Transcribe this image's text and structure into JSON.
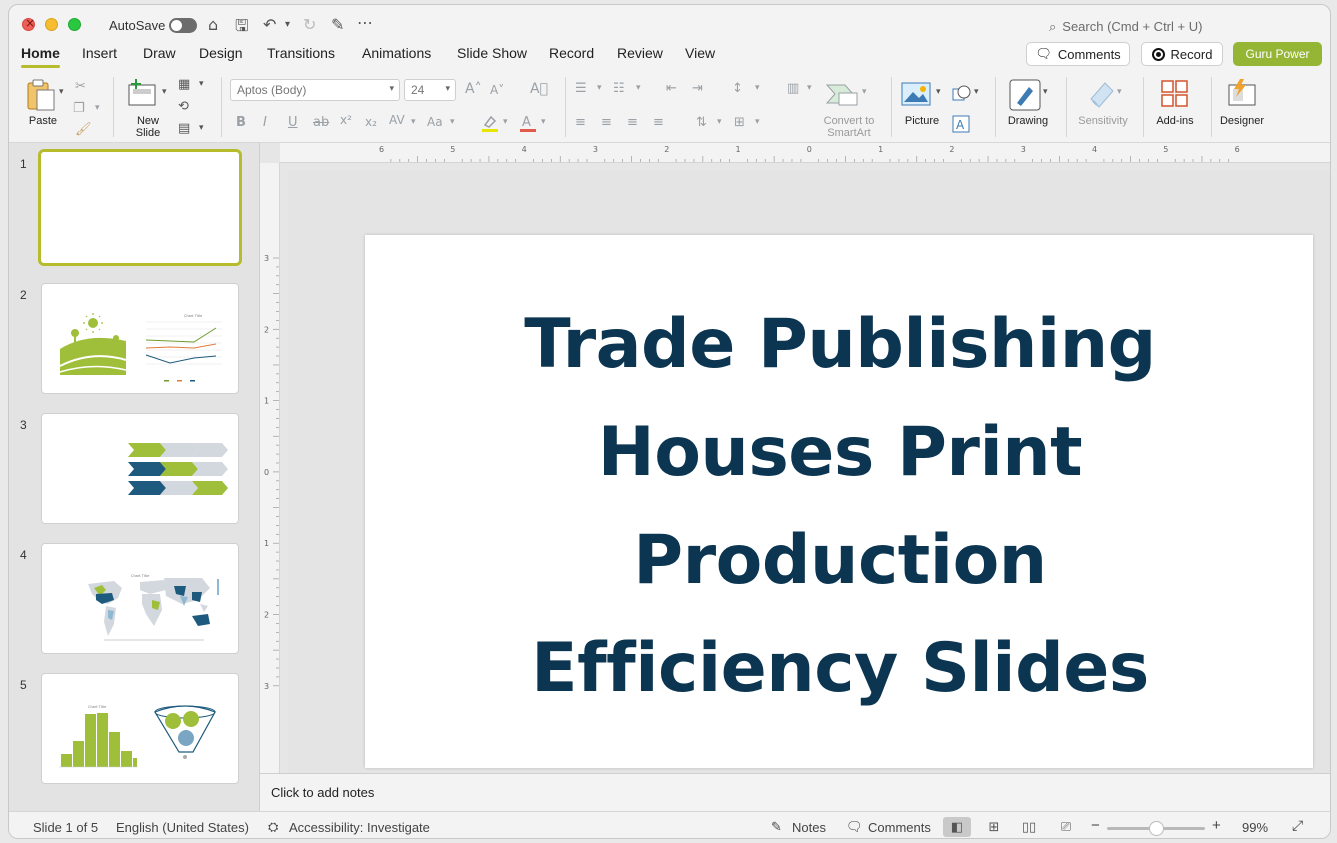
{
  "titlebar": {
    "autosave_label": "AutoSave",
    "search_placeholder": "Search (Cmd + Ctrl + U)"
  },
  "tabs": [
    {
      "label": "Home",
      "active": true
    },
    {
      "label": "Insert"
    },
    {
      "label": "Draw"
    },
    {
      "label": "Design"
    },
    {
      "label": "Transitions"
    },
    {
      "label": "Animations"
    },
    {
      "label": "Slide Show"
    },
    {
      "label": "Record"
    },
    {
      "label": "Review"
    },
    {
      "label": "View"
    }
  ],
  "header_buttons": {
    "comments": "Comments",
    "record": "Record",
    "guru": "Guru Power"
  },
  "ribbon": {
    "paste": "Paste",
    "new_slide_line1": "New",
    "new_slide_line2": "Slide",
    "font_name": "Aptos (Body)",
    "font_size": "24",
    "convert_line1": "Convert to",
    "convert_line2": "SmartArt",
    "picture": "Picture",
    "drawing": "Drawing",
    "sensitivity": "Sensitivity",
    "addins": "Add-ins",
    "designer": "Designer"
  },
  "ruler": {
    "h_labels": [
      "6",
      "5",
      "4",
      "3",
      "2",
      "1",
      "0",
      "1",
      "2",
      "3",
      "4",
      "5",
      "6"
    ],
    "v_labels": [
      "3",
      "2",
      "1",
      "0",
      "1",
      "2",
      "3"
    ]
  },
  "slides": [
    {
      "number": "1"
    },
    {
      "number": "2",
      "mini_chart_title": "Chart Title"
    },
    {
      "number": "3"
    },
    {
      "number": "4",
      "mini_chart_title": "Chart Title"
    },
    {
      "number": "5",
      "mini_chart_title": "Chart Title"
    }
  ],
  "slide": {
    "title_lines": [
      "Trade Publishing",
      "Houses Print",
      "Production",
      "Efficiency Slides"
    ]
  },
  "notes_placeholder": "Click to add notes",
  "status": {
    "slide_count": "Slide 1 of 5",
    "language": "English (United States)",
    "accessibility": "Accessibility: Investigate",
    "notes": "Notes",
    "comments": "Comments",
    "zoom": "99%",
    "zoom_level": 0.5
  },
  "colors": {
    "accent": "#b6bc2c",
    "guru": "#95b634",
    "title": "#0b3550",
    "thumb_green": "#9fbf3b",
    "thumb_blue": "#1d5a7e",
    "thumb_gray": "#d3d8de"
  }
}
